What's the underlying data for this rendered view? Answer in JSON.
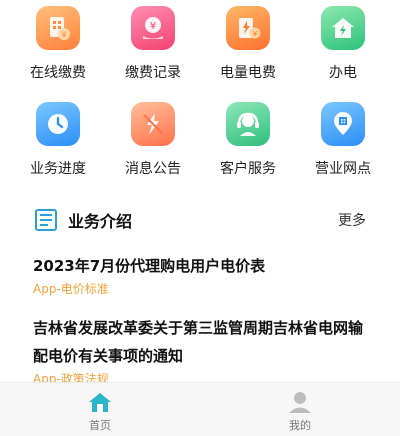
{
  "services": [
    {
      "label": "在线缴费",
      "icon": "online-payment-icon",
      "color_from": "#ffb36a",
      "color_to": "#ff7f3a"
    },
    {
      "label": "缴费记录",
      "icon": "payment-record-icon",
      "color_from": "#ff7aa8",
      "color_to": "#f2436f"
    },
    {
      "label": "电量电费",
      "icon": "electricity-bill-icon",
      "color_from": "#ffa84d",
      "color_to": "#ff6f2e"
    },
    {
      "label": "办电",
      "icon": "house-power-icon",
      "color_from": "#7be0a0",
      "color_to": "#2ec27a"
    },
    {
      "label": "业务进度",
      "icon": "clock-icon",
      "color_from": "#6bbcff",
      "color_to": "#2a8ff5"
    },
    {
      "label": "消息公告",
      "icon": "lightning-notice-icon",
      "color_from": "#ffb08a",
      "color_to": "#ff7148"
    },
    {
      "label": "客户服务",
      "icon": "headset-service-icon",
      "color_from": "#78e0a8",
      "color_to": "#2fbf7d"
    },
    {
      "label": "营业网点",
      "icon": "location-pin-icon",
      "color_from": "#6bbcff",
      "color_to": "#2a8ff5"
    }
  ],
  "section": {
    "title": "业务介绍",
    "more": "更多",
    "icon": "document-list-icon",
    "icon_color": "#2aa1d8"
  },
  "news": [
    {
      "title": "2023年7月份代理购电用户电价表",
      "tag": "App-电价标准"
    },
    {
      "title": "吉林省发展改革委关于第三监管周期吉林省电网输配电价有关事项的通知",
      "tag": "App-政策法规"
    }
  ],
  "tabbar": {
    "items": [
      {
        "label": "首页",
        "icon": "home-icon",
        "active": true
      },
      {
        "label": "我的",
        "icon": "profile-icon",
        "active": false
      }
    ],
    "active_color": "#2ab5c9",
    "inactive_color": "#bdbdbd"
  }
}
